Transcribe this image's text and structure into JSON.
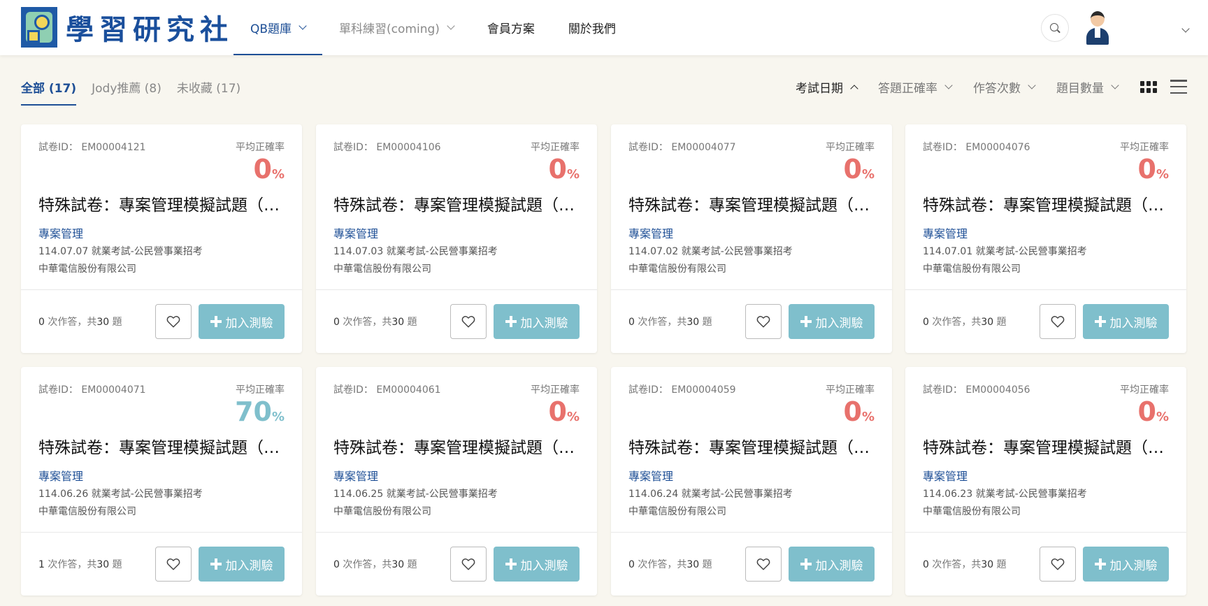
{
  "brand": {
    "name": "學習研究社"
  },
  "nav": [
    {
      "label": "QB題庫",
      "has_dropdown": true,
      "active": true
    },
    {
      "label": "單科練習(coming)",
      "has_dropdown": true,
      "active": false
    },
    {
      "label": "會員方案",
      "has_dropdown": false,
      "active": false
    },
    {
      "label": "關於我們",
      "has_dropdown": false,
      "active": false
    }
  ],
  "tabs": [
    {
      "label": "全部 (17)",
      "active": true
    },
    {
      "label": "Jody推薦 (8)",
      "active": false
    },
    {
      "label": "未收藏 (17)",
      "active": false
    }
  ],
  "sorts": [
    {
      "label": "考試日期",
      "active": true,
      "direction": "up"
    },
    {
      "label": "答題正確率",
      "active": false,
      "direction": "down"
    },
    {
      "label": "作答次數",
      "active": false,
      "direction": "down"
    },
    {
      "label": "題目數量",
      "active": false,
      "direction": "down"
    }
  ],
  "card_labels": {
    "id_prefix": "試卷ID：",
    "rate_label": "平均正確率",
    "percent_sign": "%",
    "attempts_suffix": "次作答，共",
    "questions_suffix": "題",
    "add_button": "加入測驗"
  },
  "colors": {
    "accent": "#1e4f96",
    "rate_low": "#e8716c",
    "rate_good": "#7fbfcc",
    "add_button": "#7fbfcc"
  },
  "cards": [
    {
      "id": "EM00004121",
      "rate": "0",
      "title": "特殊試卷：專案管理模擬試題（一）",
      "category": "專案管理",
      "date_exam": "114.07.07 就業考試-公民營事業招考",
      "org": "中華電信股份有限公司",
      "attempts": "0",
      "questions": "30"
    },
    {
      "id": "EM00004106",
      "rate": "0",
      "title": "特殊試卷：專案管理模擬試題（二）",
      "category": "專案管理",
      "date_exam": "114.07.03 就業考試-公民營事業招考",
      "org": "中華電信股份有限公司",
      "attempts": "0",
      "questions": "30"
    },
    {
      "id": "EM00004077",
      "rate": "0",
      "title": "特殊試卷：專案管理模擬試題（三）",
      "category": "專案管理",
      "date_exam": "114.07.02 就業考試-公民營事業招考",
      "org": "中華電信股份有限公司",
      "attempts": "0",
      "questions": "30"
    },
    {
      "id": "EM00004076",
      "rate": "0",
      "title": "特殊試卷：專案管理模擬試題（四）",
      "category": "專案管理",
      "date_exam": "114.07.01 就業考試-公民營事業招考",
      "org": "中華電信股份有限公司",
      "attempts": "0",
      "questions": "30"
    },
    {
      "id": "EM00004071",
      "rate": "70",
      "title": "特殊試卷：專案管理模擬試題（五）",
      "category": "專案管理",
      "date_exam": "114.06.26 就業考試-公民營事業招考",
      "org": "中華電信股份有限公司",
      "attempts": "1",
      "questions": "30"
    },
    {
      "id": "EM00004061",
      "rate": "0",
      "title": "特殊試卷：專案管理模擬試題（六）",
      "category": "專案管理",
      "date_exam": "114.06.25 就業考試-公民營事業招考",
      "org": "中華電信股份有限公司",
      "attempts": "0",
      "questions": "30"
    },
    {
      "id": "EM00004059",
      "rate": "0",
      "title": "特殊試卷：專案管理模擬試題（七）",
      "category": "專案管理",
      "date_exam": "114.06.24 就業考試-公民營事業招考",
      "org": "中華電信股份有限公司",
      "attempts": "0",
      "questions": "30"
    },
    {
      "id": "EM00004056",
      "rate": "0",
      "title": "特殊試卷：專案管理模擬試題（八）",
      "category": "專案管理",
      "date_exam": "114.06.23 就業考試-公民營事業招考",
      "org": "中華電信股份有限公司",
      "attempts": "0",
      "questions": "30"
    }
  ]
}
